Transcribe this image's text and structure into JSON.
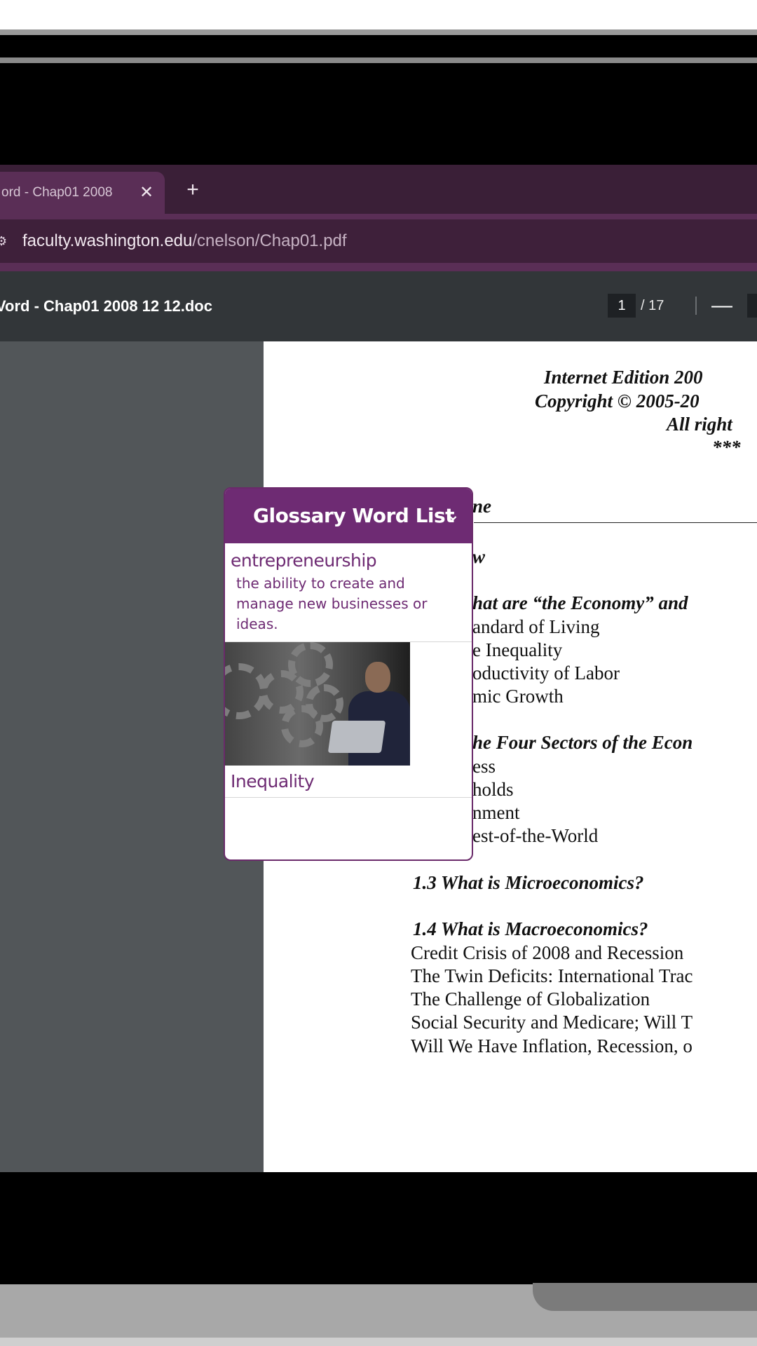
{
  "browser": {
    "tab_title": "ord - Chap01 2008",
    "tab_close": "✕",
    "new_tab": "+",
    "url_host": "faculty.washington.edu",
    "url_path": "/cnelson/Chap01.pdf"
  },
  "pdf_viewer": {
    "doc_title": "Vord - Chap01 2008 12 12.doc",
    "current_page": "1",
    "total_pages": "/ 17",
    "zoom_out": "—"
  },
  "document": {
    "header_lines": [
      "Internet Edition 200",
      "Copyright © 2005-20",
      "All right",
      "***"
    ],
    "outline_heading": "ne",
    "section_1_1_fragment": "w",
    "section_1_2_title": "hat are “the Economy” and",
    "section_1_2_items": [
      "andard of Living",
      "e Inequality",
      "oductivity of Labor",
      "mic Growth"
    ],
    "section_1_3_fragment_title": "he Four Sectors of the Econ",
    "section_1_3_items": [
      "ess",
      "holds",
      "nment",
      "est-of-the-World"
    ],
    "micro_title": "1.3 What is Microeconomics?",
    "macro_title": "1.4 What is Macroeconomics?",
    "macro_items": [
      "Credit Crisis of 2008 and Recession",
      "The Twin Deficits: International Trac",
      "The Challenge of Globalization",
      "Social Security and Medicare; Will T",
      "Will We Have Inflation, Recession, o"
    ]
  },
  "glossary": {
    "title": "Glossary Word List",
    "chevron": "⌄",
    "term1": "entrepreneurship",
    "definition1": "the ability to create and manage new businesses or ideas.",
    "term2": "Inequality"
  },
  "colors": {
    "accent": "#6e2b73",
    "tabstrip": "#3a1f37",
    "toolbar": "#5a2e56",
    "pdf_toolbar": "#323639"
  }
}
